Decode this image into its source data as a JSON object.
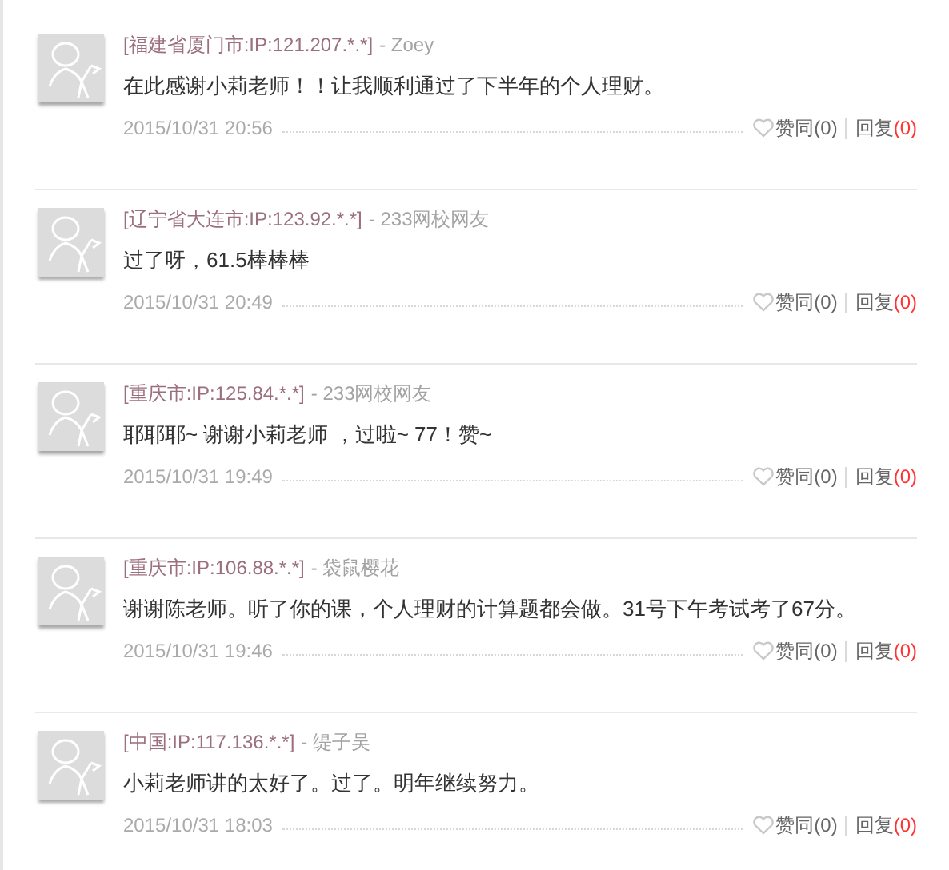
{
  "comments": [
    {
      "location": "[福建省厦门市:IP:121.207.*.*]",
      "author": "- Zoey",
      "text": "在此感谢小莉老师！！让我顺利通过了下半年的个人理财。",
      "time": "2015/10/31 20:56",
      "like_label": "赞同",
      "like_count": "(0)",
      "reply_label": "回复",
      "reply_count": "(0)"
    },
    {
      "location": "[辽宁省大连市:IP:123.92.*.*]",
      "author": "- 233网校网友",
      "text": "过了呀，61.5棒棒棒",
      "time": "2015/10/31 20:49",
      "like_label": "赞同",
      "like_count": "(0)",
      "reply_label": "回复",
      "reply_count": "(0)"
    },
    {
      "location": "[重庆市:IP:125.84.*.*]",
      "author": "- 233网校网友",
      "text": "耶耶耶~ 谢谢小莉老师 ，过啦~ 77！赞~",
      "time": "2015/10/31 19:49",
      "like_label": "赞同",
      "like_count": "(0)",
      "reply_label": "回复",
      "reply_count": "(0)"
    },
    {
      "location": "[重庆市:IP:106.88.*.*]",
      "author": "- 袋鼠樱花",
      "text": "谢谢陈老师。听了你的课，个人理财的计算题都会做。31号下午考试考了67分。",
      "time": "2015/10/31 19:46",
      "like_label": "赞同",
      "like_count": "(0)",
      "reply_label": "回复",
      "reply_count": "(0)"
    },
    {
      "location": "[中国:IP:117.136.*.*]",
      "author": "- 缇子吴",
      "text": "小莉老师讲的太好了。过了。明年继续努力。",
      "time": "2015/10/31 18:03",
      "like_label": "赞同",
      "like_count": "(0)",
      "reply_label": "回复",
      "reply_count": "(0)"
    }
  ]
}
